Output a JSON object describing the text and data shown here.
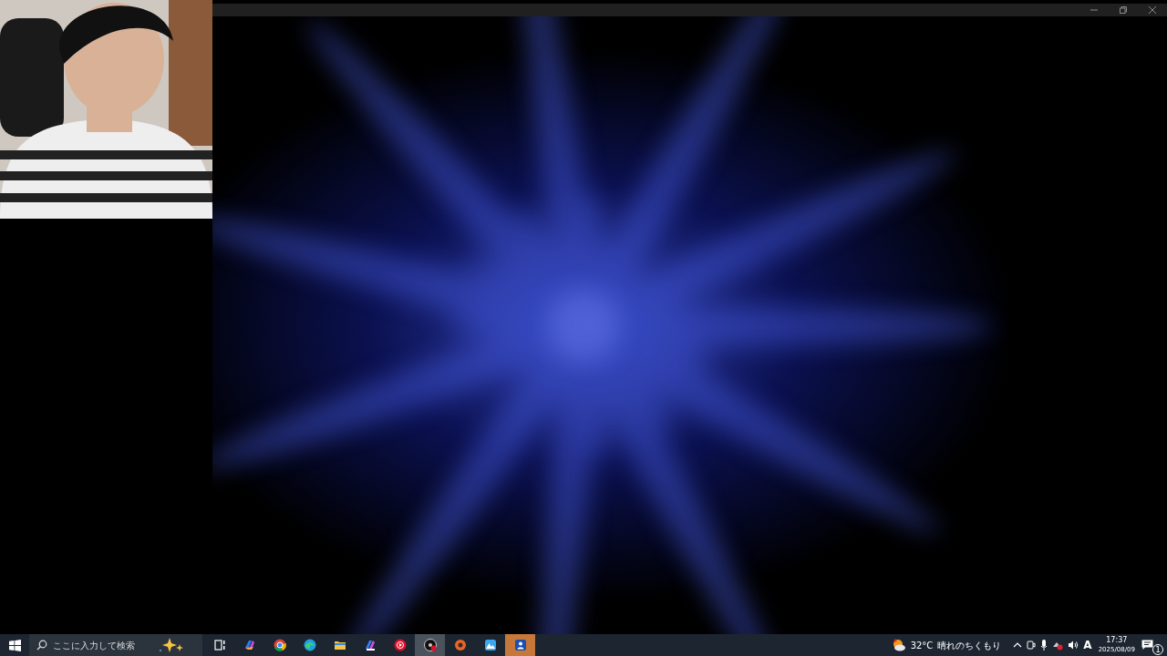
{
  "window": {
    "controls": [
      {
        "kind": "minimize"
      },
      {
        "kind": "restore"
      },
      {
        "kind": "close"
      }
    ]
  },
  "taskbar": {
    "search": {
      "placeholder": "ここに入力して検索"
    },
    "apps": [
      {
        "selected": false,
        "flashing": false
      },
      {
        "selected": false,
        "flashing": false
      },
      {
        "selected": false,
        "flashing": false
      },
      {
        "selected": false,
        "flashing": false
      },
      {
        "selected": false,
        "flashing": false
      },
      {
        "selected": false,
        "flashing": false
      },
      {
        "selected": true,
        "flashing": false
      },
      {
        "selected": false,
        "flashing": false
      },
      {
        "selected": false,
        "flashing": false
      },
      {
        "selected": false,
        "flashing": true
      }
    ],
    "weather": {
      "temperature": "32°C",
      "condition": "晴れのちくもり"
    },
    "ime": "A",
    "time": "17:37",
    "date": "2025/08/09",
    "notification_count": "1"
  }
}
